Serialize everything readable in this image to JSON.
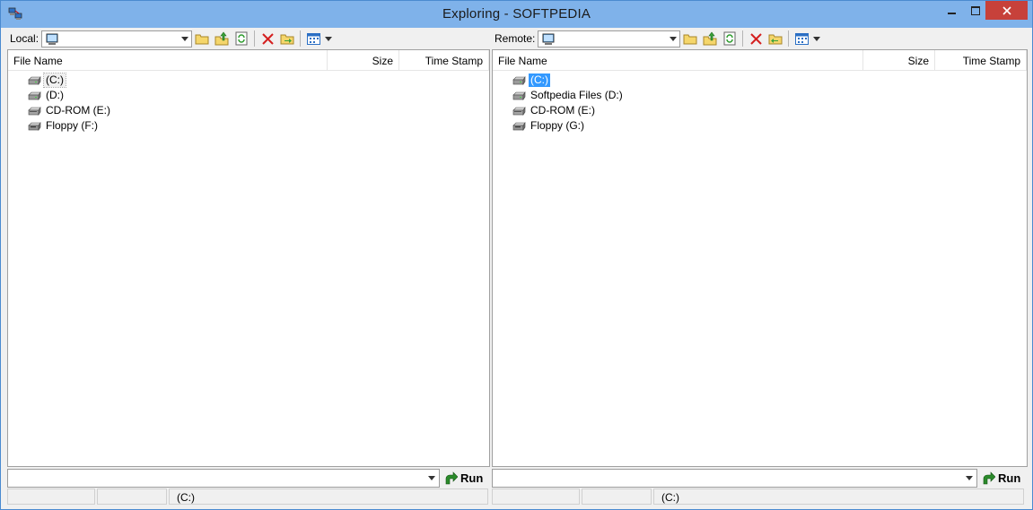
{
  "window": {
    "title": "Exploring  - SOFTPEDIA",
    "colors": {
      "titlebar": "#7fb2ea",
      "close": "#c7413a",
      "selection": "#3399ff"
    }
  },
  "local": {
    "label": "Local:",
    "columns": {
      "name": "File Name",
      "size": "Size",
      "time": "Time Stamp"
    },
    "items": [
      {
        "label": "(C:)",
        "icon": "hard-drive-icon",
        "state": "focused"
      },
      {
        "label": "(D:)",
        "icon": "hard-drive-icon",
        "state": ""
      },
      {
        "label": "CD-ROM (E:)",
        "icon": "cdrom-drive-icon",
        "state": ""
      },
      {
        "label": "Floppy (F:)",
        "icon": "floppy-drive-icon",
        "state": ""
      }
    ],
    "command": {
      "value": "",
      "run_label": "Run"
    },
    "status": [
      "",
      "",
      "(C:)"
    ]
  },
  "remote": {
    "label": "Remote:",
    "columns": {
      "name": "File Name",
      "size": "Size",
      "time": "Time Stamp"
    },
    "items": [
      {
        "label": "(C:)",
        "icon": "hard-drive-icon",
        "state": "selected"
      },
      {
        "label": "Softpedia Files (D:)",
        "icon": "hard-drive-icon",
        "state": ""
      },
      {
        "label": "CD-ROM (E:)",
        "icon": "cdrom-drive-icon",
        "state": ""
      },
      {
        "label": "Floppy (G:)",
        "icon": "floppy-drive-icon",
        "state": ""
      }
    ],
    "command": {
      "value": "",
      "run_label": "Run"
    },
    "status": [
      "",
      "",
      "(C:)"
    ]
  },
  "toolbar_icons": [
    "folder-icon",
    "up-folder-icon",
    "refresh-icon",
    "delete-icon",
    "transfer-icon",
    "view-icon",
    "view-dropdown-icon"
  ]
}
